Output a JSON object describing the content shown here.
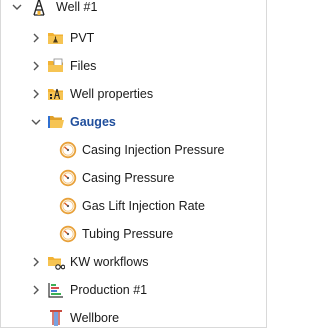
{
  "tree": {
    "root": {
      "label": "Well #1",
      "icon": "well-derrick-icon",
      "expanded": true
    },
    "children": [
      {
        "key": "pvt",
        "label": "PVT",
        "icon": "pvt-folder-icon",
        "expanded": false
      },
      {
        "key": "files",
        "label": "Files",
        "icon": "files-folder-icon",
        "expanded": false
      },
      {
        "key": "well_properties",
        "label": "Well properties",
        "icon": "well-properties-folder-icon",
        "expanded": false
      },
      {
        "key": "gauges",
        "label": "Gauges",
        "icon": "gauges-folder-icon",
        "expanded": true,
        "selected": true
      },
      {
        "key": "kw_workflows",
        "label": "KW workflows",
        "icon": "workflow-folder-icon",
        "expanded": false
      },
      {
        "key": "production",
        "label": "Production #1",
        "icon": "production-icon",
        "expanded": false
      },
      {
        "key": "wellbore",
        "label": "Wellbore",
        "icon": "wellbore-icon"
      }
    ],
    "gauges": [
      {
        "label": "Casing Injection Pressure",
        "icon": "gauge-icon"
      },
      {
        "label": "Casing Pressure",
        "icon": "gauge-icon"
      },
      {
        "label": "Gas Lift Injection Rate",
        "icon": "gauge-icon"
      },
      {
        "label": "Tubing Pressure",
        "icon": "gauge-icon"
      }
    ]
  },
  "colors": {
    "selected_text": "#1f4e9c",
    "folder": "#f2b233",
    "gauge_ring": "#e8a13a",
    "chevron": "#555555",
    "wellbore": "#c0392b"
  }
}
